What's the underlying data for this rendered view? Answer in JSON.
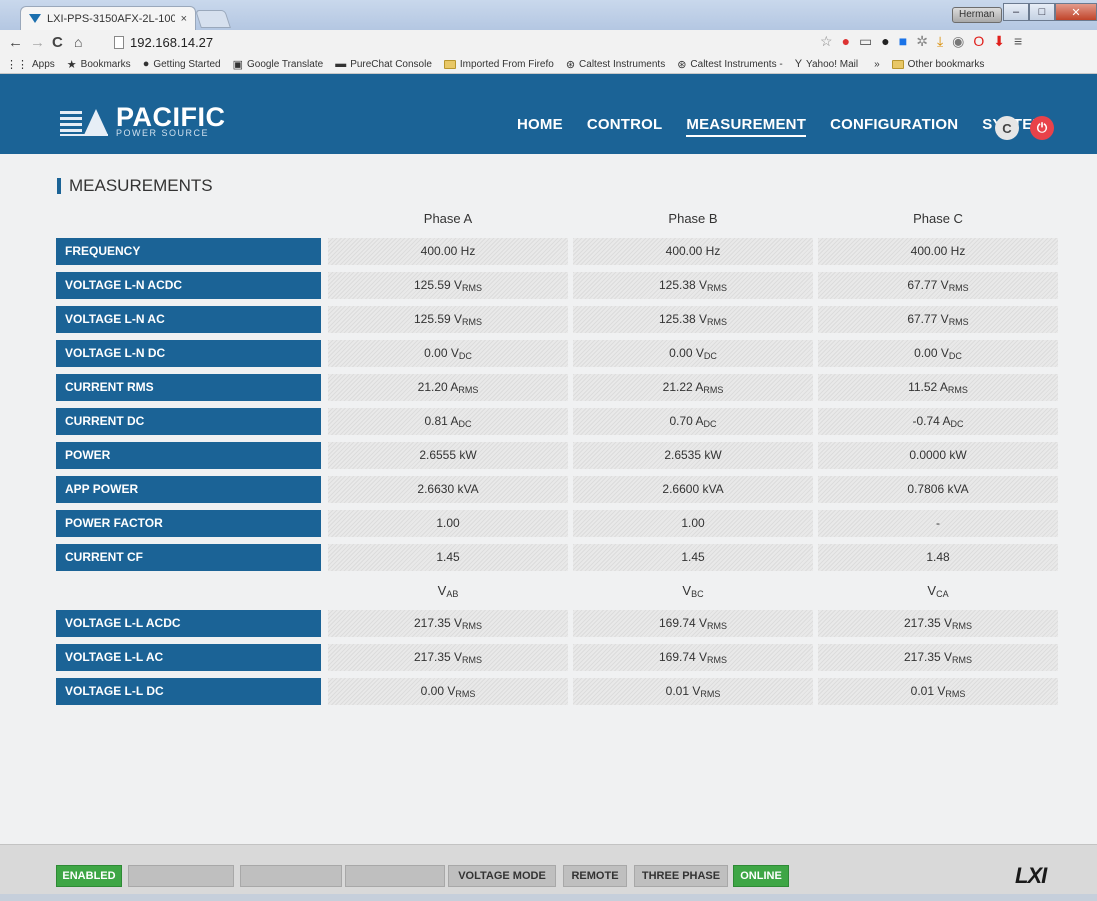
{
  "browser": {
    "tab_title": "LXI-PPS-3150AFX-2L-100...",
    "tab_close": "×",
    "user": "Herman",
    "url": "192.168.14.27",
    "bookmarks": [
      {
        "icon": "apps-icon",
        "label": "Apps"
      },
      {
        "icon": "star-icon",
        "label": "Bookmarks"
      },
      {
        "icon": "firefox-icon",
        "label": "Getting Started"
      },
      {
        "icon": "translate-icon",
        "label": "Google Translate"
      },
      {
        "icon": "chat-icon",
        "label": "PureChat Console"
      },
      {
        "icon": "folder-icon",
        "label": "Imported From Firefo"
      },
      {
        "icon": "caltest-icon",
        "label": "Caltest Instruments"
      },
      {
        "icon": "caltest-icon",
        "label": "Caltest Instruments -"
      },
      {
        "icon": "yahoo-icon",
        "label": "Yahoo! Mail"
      },
      {
        "icon": "more-icon",
        "label": "»"
      },
      {
        "icon": "folder-icon",
        "label": "Other bookmarks"
      }
    ]
  },
  "header": {
    "logo_big": "PACIFIC",
    "logo_small": "POWER SOURCE",
    "menu": [
      "HOME",
      "CONTROL",
      "MEASUREMENT",
      "CONFIGURATION",
      "SYSTEM"
    ],
    "active_menu": "MEASUREMENT",
    "refresh_symbol": "C",
    "power_symbol": "⏻"
  },
  "measurements": {
    "title": "MEASUREMENTS",
    "phase_headers": [
      "Phase A",
      "Phase B",
      "Phase C"
    ],
    "line_headers": [
      {
        "base": "V",
        "sub": "AB"
      },
      {
        "base": "V",
        "sub": "BC"
      },
      {
        "base": "V",
        "sub": "CA"
      }
    ],
    "phase_rows": [
      {
        "label": "FREQUENCY",
        "values": [
          {
            "v": "400.00 Hz",
            "u": ""
          },
          {
            "v": "400.00 Hz",
            "u": ""
          },
          {
            "v": "400.00 Hz",
            "u": ""
          }
        ]
      },
      {
        "label": "VOLTAGE L-N ACDC",
        "values": [
          {
            "v": "125.59 V",
            "u": "RMS"
          },
          {
            "v": "125.38 V",
            "u": "RMS"
          },
          {
            "v": "67.77 V",
            "u": "RMS"
          }
        ]
      },
      {
        "label": "VOLTAGE L-N AC",
        "values": [
          {
            "v": "125.59 V",
            "u": "RMS"
          },
          {
            "v": "125.38 V",
            "u": "RMS"
          },
          {
            "v": "67.77 V",
            "u": "RMS"
          }
        ]
      },
      {
        "label": "VOLTAGE L-N DC",
        "values": [
          {
            "v": "0.00 V",
            "u": "DC"
          },
          {
            "v": "0.00 V",
            "u": "DC"
          },
          {
            "v": "0.00 V",
            "u": "DC"
          }
        ]
      },
      {
        "label": "CURRENT RMS",
        "values": [
          {
            "v": "21.20 A",
            "u": "RMS"
          },
          {
            "v": "21.22 A",
            "u": "RMS"
          },
          {
            "v": "11.52 A",
            "u": "RMS"
          }
        ]
      },
      {
        "label": "CURRENT DC",
        "values": [
          {
            "v": "0.81 A",
            "u": "DC"
          },
          {
            "v": "0.70 A",
            "u": "DC"
          },
          {
            "v": "-0.74 A",
            "u": "DC"
          }
        ]
      },
      {
        "label": "POWER",
        "values": [
          {
            "v": "2.6555 kW",
            "u": ""
          },
          {
            "v": "2.6535 kW",
            "u": ""
          },
          {
            "v": "0.0000 kW",
            "u": ""
          }
        ]
      },
      {
        "label": "APP POWER",
        "values": [
          {
            "v": "2.6630 kVA",
            "u": ""
          },
          {
            "v": "2.6600 kVA",
            "u": ""
          },
          {
            "v": "0.7806 kVA",
            "u": ""
          }
        ]
      },
      {
        "label": "POWER FACTOR",
        "values": [
          {
            "v": "1.00",
            "u": ""
          },
          {
            "v": "1.00",
            "u": ""
          },
          {
            "v": "-",
            "u": ""
          }
        ]
      },
      {
        "label": "CURRENT CF",
        "values": [
          {
            "v": "1.45",
            "u": ""
          },
          {
            "v": "1.45",
            "u": ""
          },
          {
            "v": "1.48",
            "u": ""
          }
        ]
      }
    ],
    "line_rows": [
      {
        "label": "VOLTAGE L-L ACDC",
        "values": [
          {
            "v": "217.35 V",
            "u": "RMS"
          },
          {
            "v": "169.74 V",
            "u": "RMS"
          },
          {
            "v": "217.35 V",
            "u": "RMS"
          }
        ]
      },
      {
        "label": "VOLTAGE L-L AC",
        "values": [
          {
            "v": "217.35 V",
            "u": "RMS"
          },
          {
            "v": "169.74 V",
            "u": "RMS"
          },
          {
            "v": "217.35 V",
            "u": "RMS"
          }
        ]
      },
      {
        "label": "VOLTAGE L-L DC",
        "values": [
          {
            "v": "0.00 V",
            "u": "RMS"
          },
          {
            "v": "0.01 V",
            "u": "RMS"
          },
          {
            "v": "0.01 V",
            "u": "RMS"
          }
        ]
      }
    ]
  },
  "statusbar": {
    "slots": [
      {
        "text": "ENABLED",
        "state": "on"
      },
      {
        "text": "",
        "state": "off"
      },
      {
        "text": "",
        "state": "off"
      },
      {
        "text": "",
        "state": "off"
      },
      {
        "text": "VOLTAGE MODE",
        "state": "off"
      },
      {
        "text": "REMOTE",
        "state": "off"
      },
      {
        "text": "THREE PHASE",
        "state": "off"
      },
      {
        "text": "ONLINE",
        "state": "on"
      }
    ],
    "logo": "LXI"
  },
  "colors": {
    "brand_blue": "#1b6396",
    "status_green": "#3ea645",
    "power_red": "#e8424a"
  }
}
